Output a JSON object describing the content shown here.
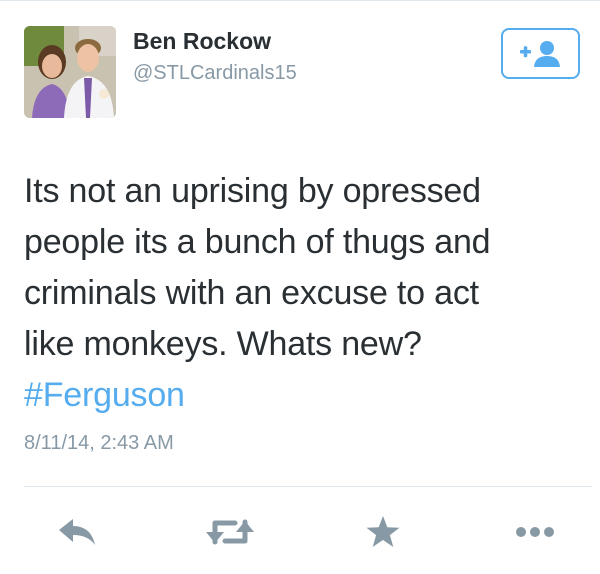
{
  "author": {
    "display_name": "Ben Rockow",
    "handle": "@STLCardinals15"
  },
  "tweet": {
    "lines": [
      "Its not an uprising by opressed",
      "people its a bunch of thugs and",
      "criminals with an excuse to act",
      "like monkeys. Whats new?"
    ],
    "hashtag": "#Ferguson",
    "timestamp": "8/11/14, 2:43 AM"
  },
  "icons": {
    "follow": "add-user-icon",
    "reply": "reply-icon",
    "retweet": "retweet-icon",
    "favorite": "star-icon",
    "more": "more-icon"
  },
  "colors": {
    "accent": "#55acee",
    "text": "#292f33",
    "muted": "#8899a6",
    "icon": "#8899a6"
  }
}
